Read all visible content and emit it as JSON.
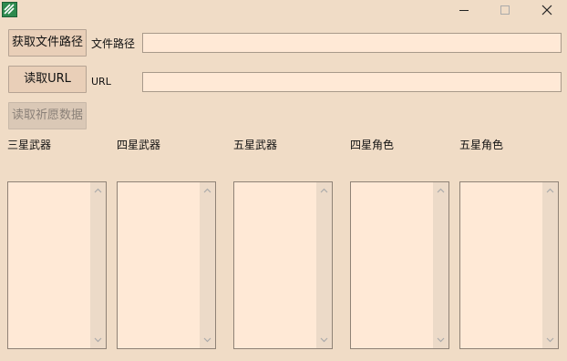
{
  "titlebar": {
    "icon": "app-icon",
    "controls": [
      "minimize-icon",
      "maximize-icon",
      "close-icon"
    ]
  },
  "row1": {
    "button_label": "获取文件路径",
    "field_label": "文件路径",
    "field_value": ""
  },
  "row2": {
    "button_label": "读取URL",
    "field_label": "URL",
    "field_value": ""
  },
  "row3": {
    "button_label": "读取祈愿数据"
  },
  "columns": [
    {
      "label": "三星武器"
    },
    {
      "label": "四星武器"
    },
    {
      "label": "五星武器"
    },
    {
      "label": "四星角色"
    },
    {
      "label": "五星角色"
    }
  ],
  "colors": {
    "window_bg": "#f0dcc6",
    "field_bg": "#ffe9d6",
    "button_bg": "#e9cfb8"
  }
}
